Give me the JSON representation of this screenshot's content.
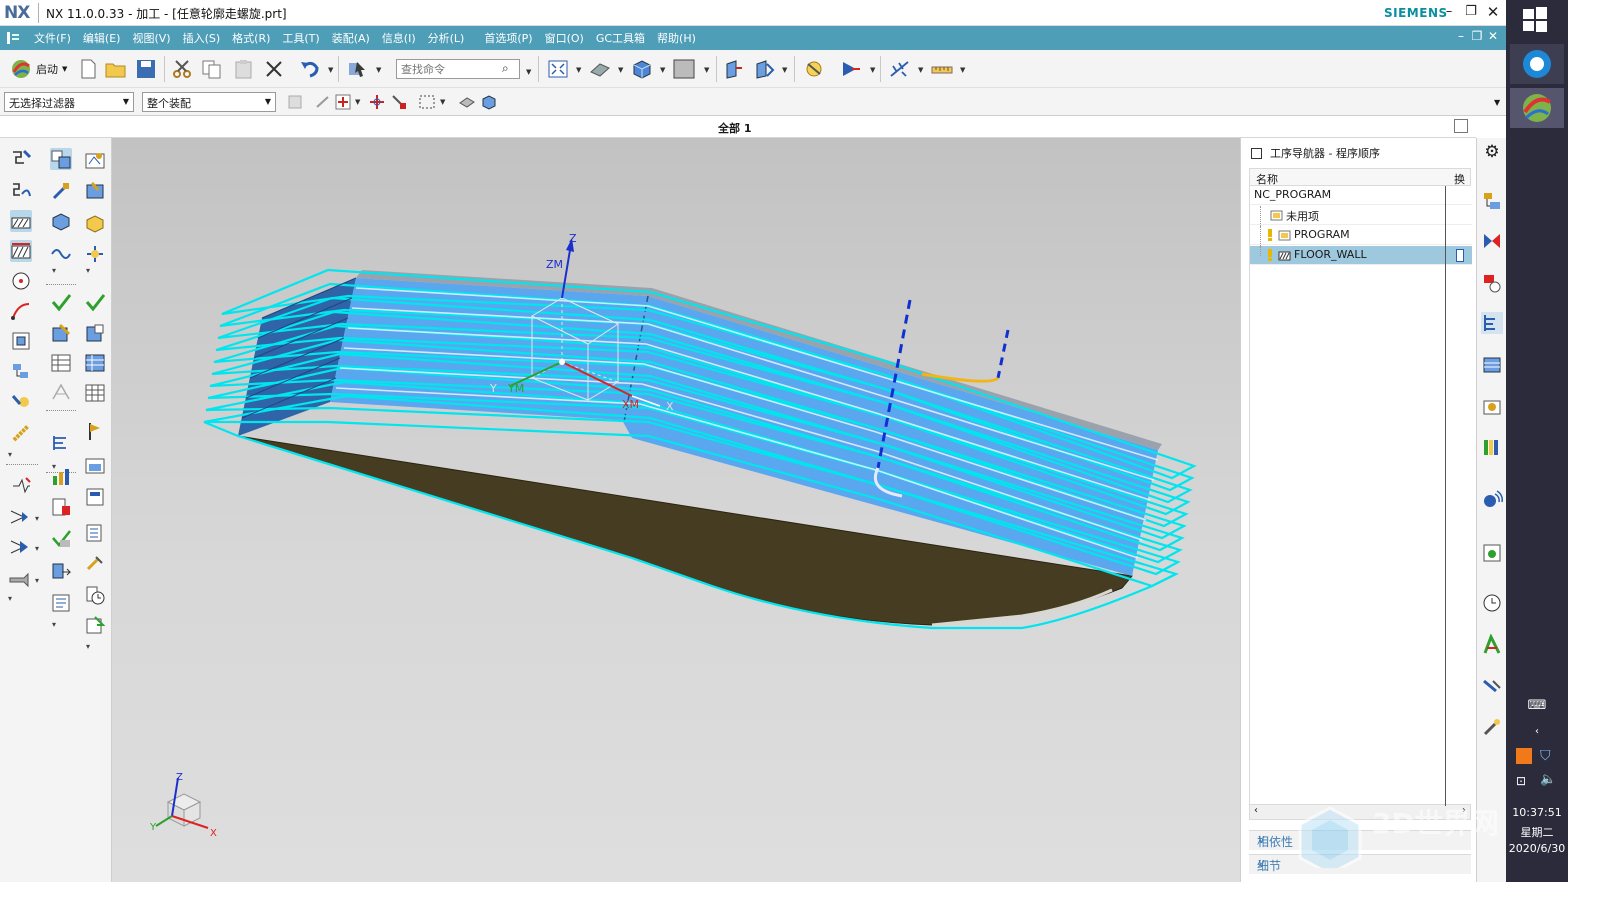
{
  "window": {
    "app_logo": "NX",
    "title": "NX 11.0.0.33 - 加工 - [任意轮廓走螺旋.prt]",
    "brand": "SIEMENS"
  },
  "menu": {
    "items": [
      "文件(F)",
      "编辑(E)",
      "视图(V)",
      "插入(S)",
      "格式(R)",
      "工具(T)",
      "装配(A)",
      "信息(I)",
      "分析(L)",
      "首选项(P)",
      "窗口(O)",
      "GC工具箱",
      "帮助(H)"
    ]
  },
  "toolbar": {
    "start_label": "启动",
    "command_search_placeholder": "查找命令",
    "filter_value": "无选择过滤器",
    "assembly_scope_value": "整个装配"
  },
  "viewport": {
    "tab_label": "全部 1",
    "csys_labels": {
      "z": "Z",
      "zm": "ZM",
      "y": "Y",
      "ym": "YM",
      "xm": "XM",
      "x": "X"
    },
    "triad_labels": {
      "z": "Z",
      "y": "Y",
      "x": "X"
    }
  },
  "navigator": {
    "title": "工序导航器 - 程序顺序",
    "column_name": "名称",
    "column_tool": "换",
    "rows": [
      {
        "label": "NC_PROGRAM",
        "level": 0
      },
      {
        "label": "未用项",
        "level": 1
      },
      {
        "label": "PROGRAM",
        "level": 1
      },
      {
        "label": "FLOOR_WALL",
        "level": 1,
        "selected": true
      }
    ],
    "sections": [
      "相依性",
      "细节"
    ]
  },
  "taskbar": {
    "time": "10:37:51",
    "weekday": "星期二",
    "date": "2020/6/30"
  },
  "watermark": {
    "text": "3D世界网"
  },
  "colors": {
    "menu_bar": "#4f9eb8",
    "brand": "#0a8fa0",
    "toolpath": "#00e5ee",
    "wall_face": "#5aa7f0",
    "floor_face": "#463c22",
    "selected_row": "#9ec8de",
    "approach_move": "#1030d0",
    "retract_move": "#f2b416"
  }
}
